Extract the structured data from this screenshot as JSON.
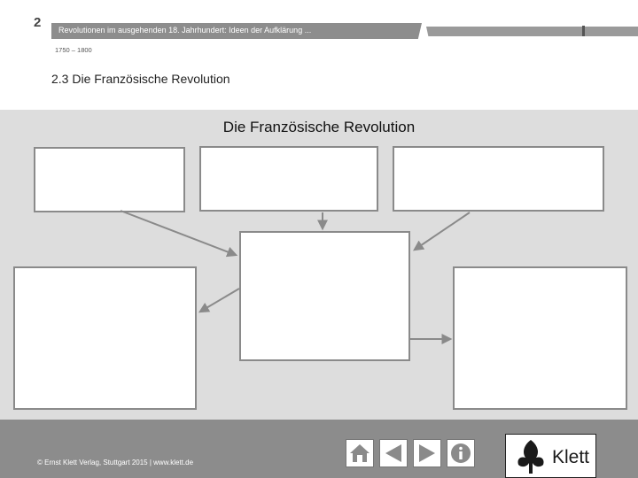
{
  "header": {
    "chapter_number": "2",
    "title": "Revolutionen im ausgehenden 18. Jahrhundert: Ideen der Aufklärung ...",
    "period": "1750 – 1800",
    "section_title": "2.3 Die Französische Revolution"
  },
  "main": {
    "diagram_title": "Die Französische Revolution"
  },
  "footer": {
    "copyright": "© Ernst Klett Verlag, Stuttgart 2015 | www.klett.de",
    "logo_text": "Klett"
  },
  "nav": {
    "buttons": [
      "home",
      "back",
      "forward",
      "info"
    ]
  }
}
